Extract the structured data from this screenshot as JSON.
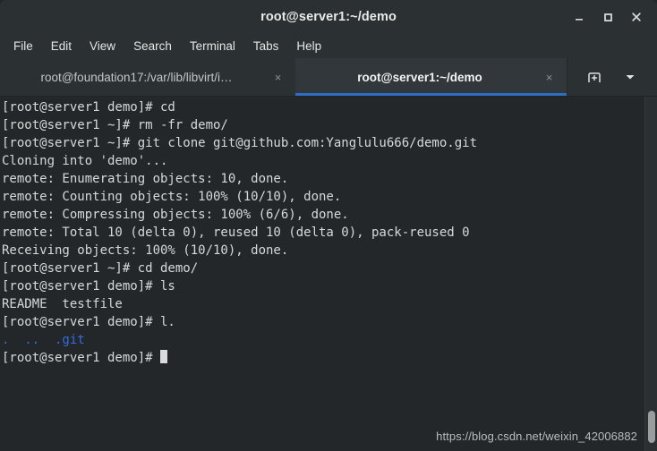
{
  "window": {
    "title": "root@server1:~/demo",
    "controls": [
      {
        "name": "minimize-button",
        "glyph": "minimize"
      },
      {
        "name": "maximize-button",
        "glyph": "maximize"
      },
      {
        "name": "close-button",
        "glyph": "close"
      }
    ]
  },
  "menubar": {
    "items": [
      {
        "label": "File"
      },
      {
        "label": "Edit"
      },
      {
        "label": "View"
      },
      {
        "label": "Search"
      },
      {
        "label": "Terminal"
      },
      {
        "label": "Tabs"
      },
      {
        "label": "Help"
      }
    ]
  },
  "tabbar": {
    "tabs": [
      {
        "label": "root@foundation17:/var/lib/libvirt/i…",
        "close": "×",
        "active": false
      },
      {
        "label": "root@server1:~/demo",
        "close": "×",
        "active": true
      }
    ],
    "new_tab_icon": "new-tab-icon",
    "tab_list_icon": "chevron-down-icon",
    "active_underline_color": "#2e6fc4"
  },
  "terminal": {
    "background": "#242729",
    "foreground": "#d6d9da",
    "blue": "#2f6fdf",
    "lines": [
      {
        "text": "[root@server1 demo]# cd"
      },
      {
        "text": "[root@server1 ~]# rm -fr demo/"
      },
      {
        "text": "[root@server1 ~]# git clone git@github.com:Yanglulu666/demo.git"
      },
      {
        "text": "Cloning into 'demo'..."
      },
      {
        "text": "remote: Enumerating objects: 10, done."
      },
      {
        "text": "remote: Counting objects: 100% (10/10), done."
      },
      {
        "text": "remote: Compressing objects: 100% (6/6), done."
      },
      {
        "text": "remote: Total 10 (delta 0), reused 10 (delta 0), pack-reused 0"
      },
      {
        "text": "Receiving objects: 100% (10/10), done."
      },
      {
        "text": "[root@server1 ~]# cd demo/"
      },
      {
        "text": "[root@server1 demo]# ls"
      },
      {
        "text": "README  testfile"
      },
      {
        "text": "[root@server1 demo]# l."
      },
      {
        "text": ".  ..  .git",
        "color": "blue"
      },
      {
        "text": "[root@server1 demo]# ",
        "cursor": true
      }
    ]
  },
  "watermark": {
    "text": "https://blog.csdn.net/weixin_42006882"
  }
}
